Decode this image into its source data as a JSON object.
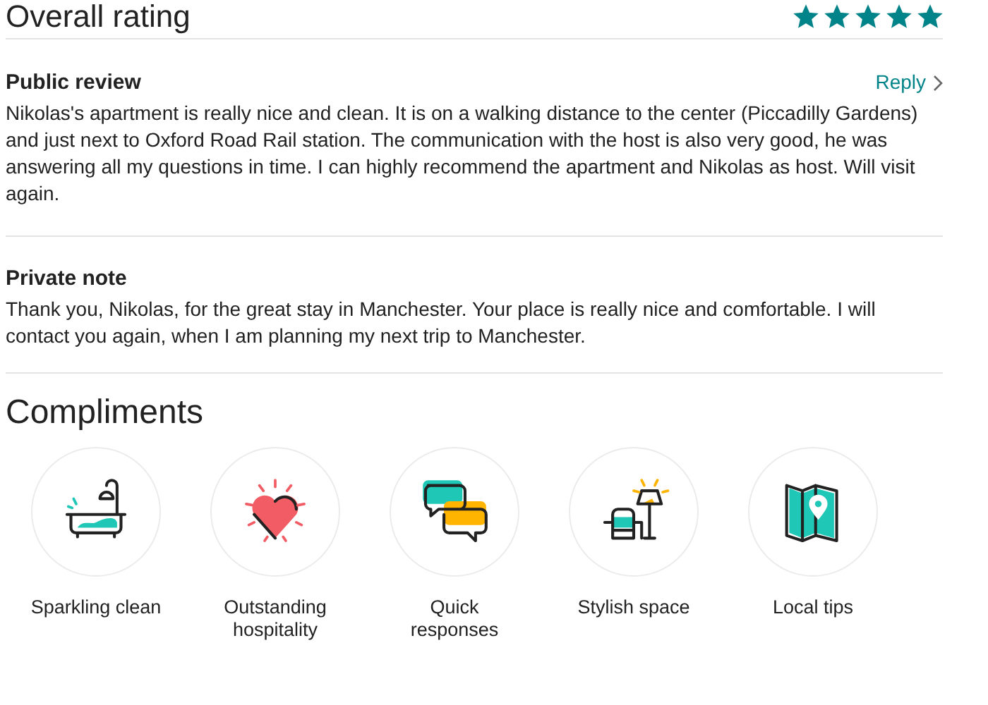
{
  "overall_rating": {
    "title": "Overall rating",
    "stars": 5
  },
  "public_review": {
    "title": "Public review",
    "reply_link": "Reply",
    "text": "Nikolas's apartment is really nice and clean. It is on a walking distance to the center (Piccadilly Gardens) and just next to Oxford Road Rail station. The communication with the host is also very good, he was answering all my questions in time. I can highly recommend the apartment and Nikolas as host. Will visit again."
  },
  "private_note": {
    "title": "Private note",
    "text": "Thank you, Nikolas, for the great stay in Manchester. Your place is really nice and comfortable. I will contact you again, when I am planning my next trip to Manchester."
  },
  "compliments": {
    "title": "Compliments",
    "items": [
      {
        "kind": "bath",
        "label": "Sparkling clean"
      },
      {
        "kind": "heart",
        "label": "Outstanding hospitality"
      },
      {
        "kind": "chat",
        "label": "Quick responses"
      },
      {
        "kind": "lamp",
        "label": "Stylish space"
      },
      {
        "kind": "map",
        "label": "Local tips"
      }
    ]
  }
}
